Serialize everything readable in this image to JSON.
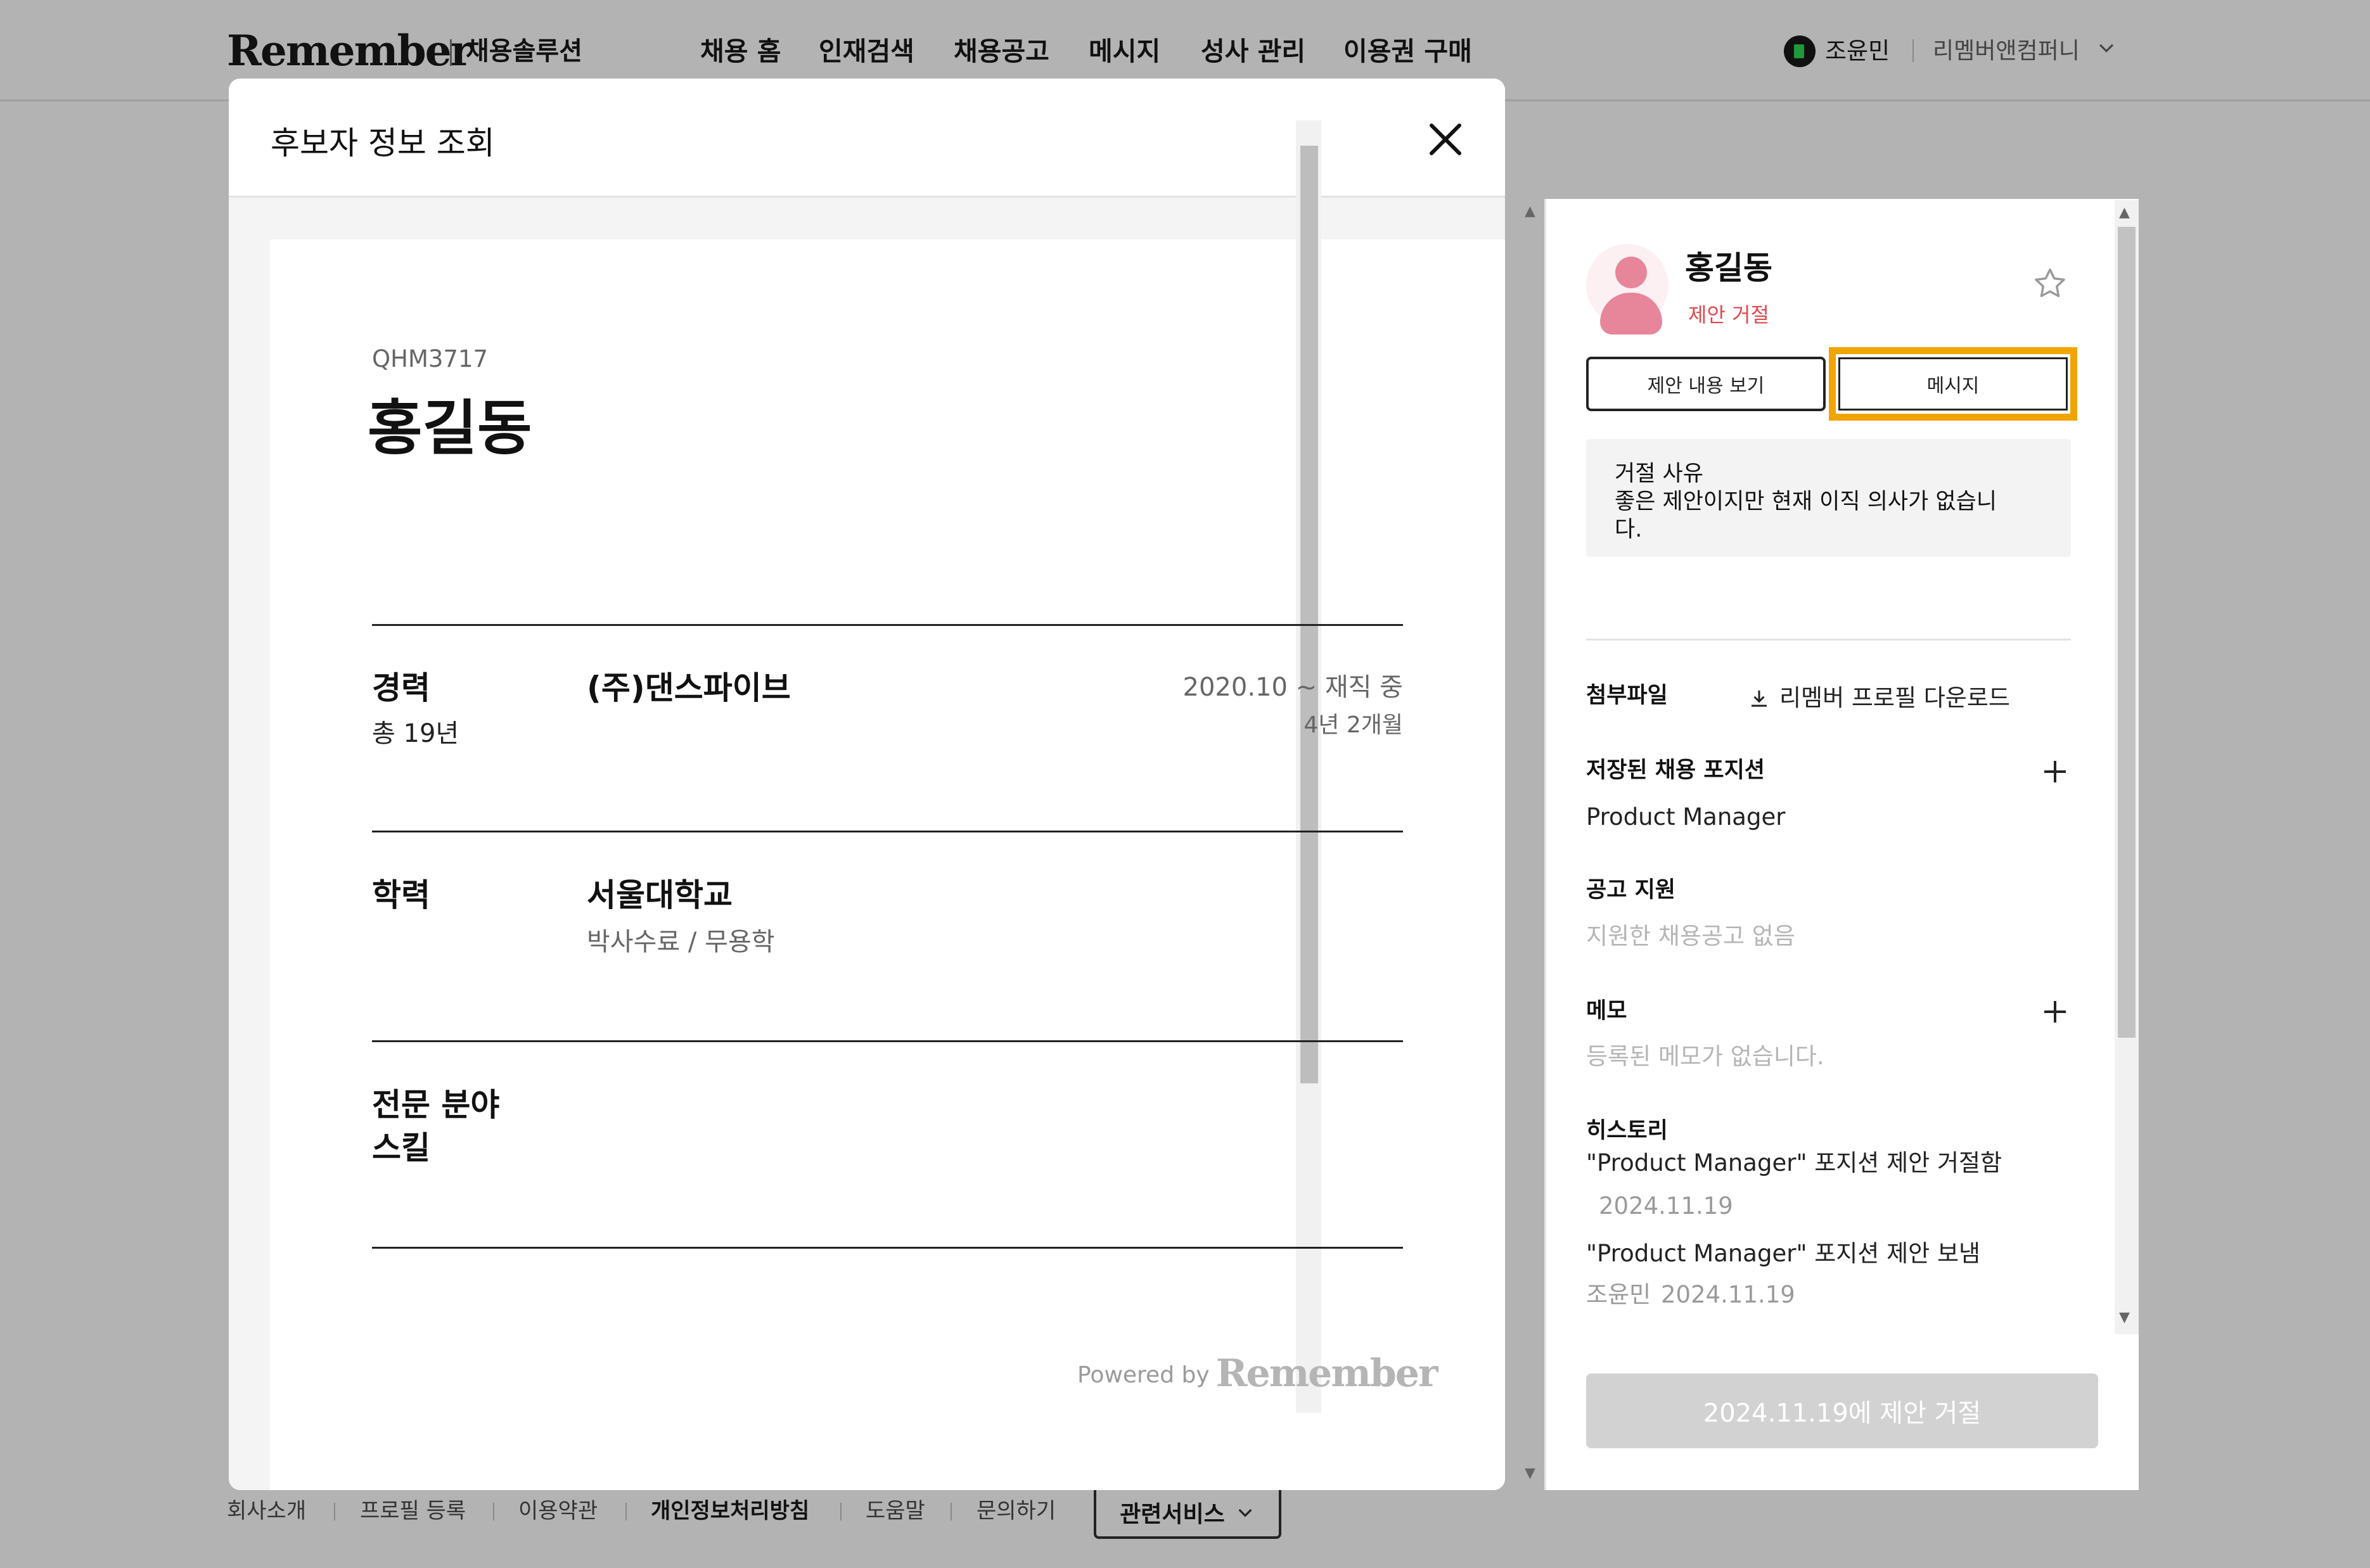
{
  "brand": {
    "logo": "Remember",
    "product": "채용솔루션"
  },
  "nav": {
    "items": [
      "채용 홈",
      "인재검색",
      "채용공고",
      "메시지",
      "성사 관리",
      "이용권 구매"
    ],
    "user_name": "조윤민",
    "company": "리멤버앤컴퍼니"
  },
  "footer": {
    "links": [
      "회사소개",
      "프로필 등록",
      "이용약관",
      "개인정보처리방침",
      "도움말",
      "문의하기"
    ],
    "related_services": "관련서비스"
  },
  "modal": {
    "title": "후보자 정보 조회",
    "resume": {
      "code": "QHM3717",
      "name": "홍길동",
      "career": {
        "label": "경력",
        "total": "총 19년",
        "company": "(주)댄스파이브",
        "period": "2020.10 ~ 재직 중",
        "duration": "4년 2개월"
      },
      "education": {
        "label": "학력",
        "school": "서울대학교",
        "degree": "박사수료 / 무용학"
      },
      "specialty": {
        "label_line1": "전문 분야",
        "label_line2": "스킬"
      },
      "powered_by": "Powered by",
      "powered_logo": "Remember"
    },
    "side": {
      "name": "홍길동",
      "status": "제안 거절",
      "status_color": "#e0474c",
      "view_offer_button": "제안 내용 보기",
      "message_button": "메시지",
      "highlight_color": "#f0a400",
      "reason_title": "거절 사유",
      "reason_text": "좋은 제안이지만 현재 이직 의사가 없습니다.",
      "attachments_label": "첨부파일",
      "download_label": "리멤버 프로필 다운로드",
      "saved_position_label": "저장된 채용 포지션",
      "saved_position_value": "Product Manager",
      "applications_label": "공고 지원",
      "applications_empty": "지원한 채용공고 없음",
      "memo_label": "메모",
      "memo_empty": "등록된 메모가 없습니다.",
      "history_label": "히스토리",
      "history": [
        {
          "text": "\"Product Manager\" 포지션 제안 거절함",
          "author": "",
          "date": "2024.11.19"
        },
        {
          "text": "\"Product Manager\" 포지션 제안 보냄",
          "author": "조윤민",
          "date": "2024.11.19"
        }
      ],
      "bottom_button": "2024.11.19에 제안 거절"
    }
  }
}
